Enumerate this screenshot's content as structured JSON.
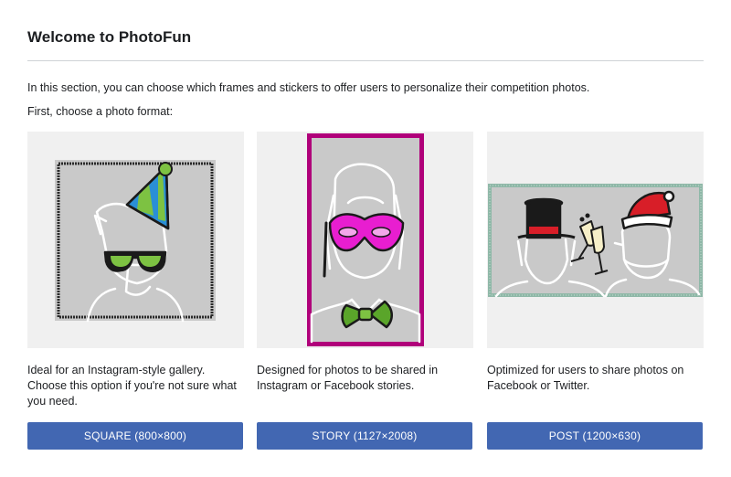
{
  "dialog": {
    "title": "Welcome to PhotoFun",
    "intro": "In this section, you can choose which frames and stickers to offer users to personalize their competition photos.",
    "subheading": "First, choose a photo format:"
  },
  "formats": [
    {
      "description": "Ideal for an Instagram-style gallery. Choose this option if you're not sure what you need.",
      "button_label": "SQUARE (800×800)"
    },
    {
      "description": "Designed for photos to be shared in Instagram or Facebook stories.",
      "button_label": "STORY (1127×2008)"
    },
    {
      "description": "Optimized for users to share photos on Facebook or Twitter.",
      "button_label": "POST (1200×630)"
    }
  ],
  "colors": {
    "button": "#4267b2",
    "story_frame": "#b0007a",
    "post_frame": "#8fb8a8",
    "mask": "#e81ed0",
    "bowtie": "#5aa52a",
    "hat_stripe_blue": "#2a8fd6",
    "hat_stripe_green": "#7dc242",
    "santa_hat": "#d81e28",
    "top_hat": "#1a1a1a"
  }
}
